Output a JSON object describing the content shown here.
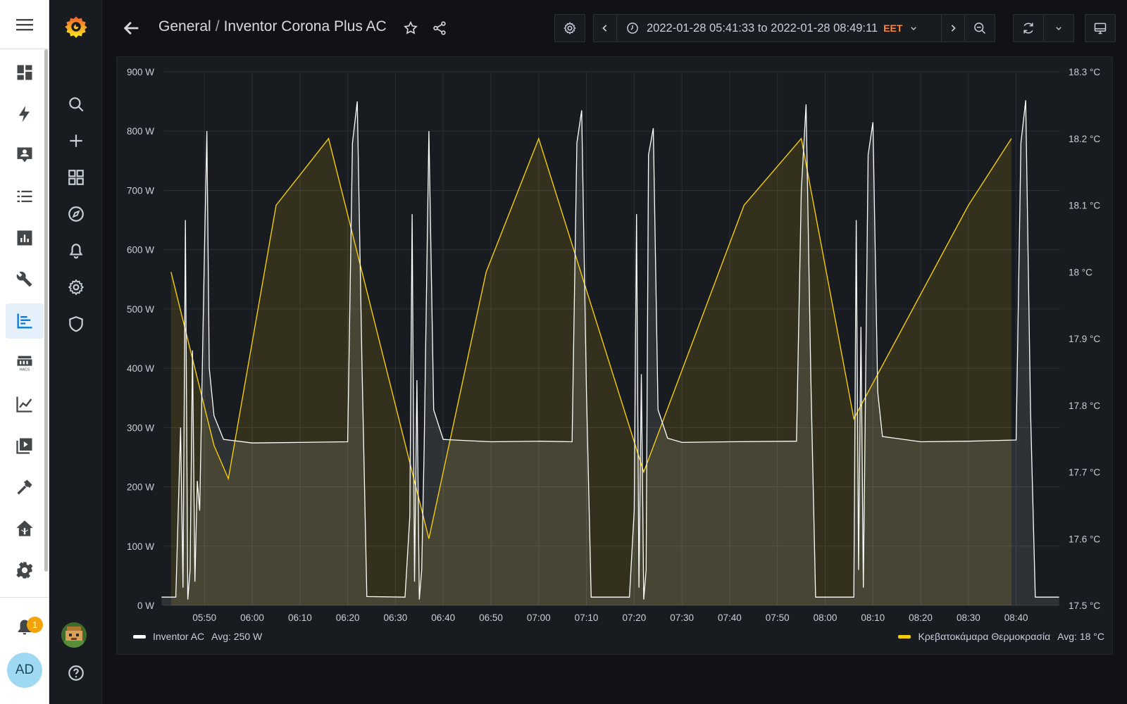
{
  "breadcrumb": {
    "folder": "General",
    "separator": "/",
    "dashboard": "Inventor Corona Plus AC"
  },
  "time_picker": {
    "range": "2022-01-28 05:41:33 to 2022-01-28 08:49:11",
    "timezone": "EET"
  },
  "notifications": {
    "count": "1"
  },
  "user": {
    "initials": "AD"
  },
  "colors": {
    "power": "#ffffff",
    "temperature": "#f2cc0c",
    "accent": "#f5883a"
  },
  "chart_data": {
    "type": "line",
    "x_ticks": [
      "05:50",
      "06:00",
      "06:10",
      "06:20",
      "06:30",
      "06:40",
      "06:50",
      "07:00",
      "07:10",
      "07:20",
      "07:30",
      "07:40",
      "07:50",
      "08:00",
      "08:10",
      "08:20",
      "08:30",
      "08:40"
    ],
    "y_left_ticks": [
      "900 W",
      "800 W",
      "700 W",
      "600 W",
      "500 W",
      "400 W",
      "300 W",
      "200 W",
      "100 W",
      "0 W"
    ],
    "y_right_ticks": [
      "18.3 °C",
      "18.2 °C",
      "18.1 °C",
      "18 °C",
      "17.9 °C",
      "17.8 °C",
      "17.7 °C",
      "17.6 °C",
      "17.5 °C"
    ],
    "y_left_range": [
      0,
      900
    ],
    "y_right_range": [
      17.5,
      18.3
    ],
    "grid": true,
    "series": [
      {
        "name": "Inventor AC",
        "legend_stat": "Avg: 250 W",
        "axis": "left",
        "points": [
          [
            "05:41",
            14
          ],
          [
            "05:44",
            14
          ],
          [
            "05:45",
            300
          ],
          [
            "05:45.5",
            30
          ],
          [
            "05:46",
            650
          ],
          [
            "05:46.5",
            10
          ],
          [
            "05:47",
            60
          ],
          [
            "05:47.5",
            430
          ],
          [
            "05:48",
            40
          ],
          [
            "05:48.5",
            210
          ],
          [
            "05:49",
            160
          ],
          [
            "05:50",
            600
          ],
          [
            "05:50.5",
            800
          ],
          [
            "05:51",
            400
          ],
          [
            "05:52",
            320
          ],
          [
            "05:54",
            280
          ],
          [
            "06:00",
            274
          ],
          [
            "06:10",
            275
          ],
          [
            "06:20",
            276
          ],
          [
            "06:21",
            780
          ],
          [
            "06:22",
            850
          ],
          [
            "06:23",
            400
          ],
          [
            "06:24",
            15
          ],
          [
            "06:32",
            14
          ],
          [
            "06:33",
            150
          ],
          [
            "06:33.5",
            660
          ],
          [
            "06:34",
            40
          ],
          [
            "06:34.5",
            380
          ],
          [
            "06:35",
            10
          ],
          [
            "06:35.5",
            60
          ],
          [
            "06:36",
            260
          ],
          [
            "06:37",
            800
          ],
          [
            "06:38",
            330
          ],
          [
            "06:40",
            280
          ],
          [
            "06:50",
            276
          ],
          [
            "07:00",
            277
          ],
          [
            "07:07",
            276
          ],
          [
            "07:08",
            780
          ],
          [
            "07:09",
            835
          ],
          [
            "07:10",
            360
          ],
          [
            "07:11",
            14
          ],
          [
            "07:19",
            14
          ],
          [
            "07:20",
            160
          ],
          [
            "07:20.5",
            660
          ],
          [
            "07:21",
            30
          ],
          [
            "07:21.5",
            390
          ],
          [
            "07:22",
            10
          ],
          [
            "07:22.5",
            60
          ],
          [
            "07:23",
            760
          ],
          [
            "07:24",
            805
          ],
          [
            "07:25",
            330
          ],
          [
            "07:27",
            282
          ],
          [
            "07:30",
            275
          ],
          [
            "07:40",
            276
          ],
          [
            "07:54",
            277
          ],
          [
            "07:55",
            700
          ],
          [
            "07:56",
            845
          ],
          [
            "07:57",
            380
          ],
          [
            "07:58",
            14
          ],
          [
            "08:06",
            14
          ],
          [
            "08:06.5",
            650
          ],
          [
            "08:07",
            60
          ],
          [
            "08:07.5",
            470
          ],
          [
            "08:08",
            30
          ],
          [
            "08:09",
            760
          ],
          [
            "08:10",
            815
          ],
          [
            "08:11",
            360
          ],
          [
            "08:12",
            285
          ],
          [
            "08:20",
            276
          ],
          [
            "08:30",
            277
          ],
          [
            "08:40",
            279
          ],
          [
            "08:41",
            780
          ],
          [
            "08:42",
            852
          ],
          [
            "08:43",
            330
          ],
          [
            "08:44",
            14
          ],
          [
            "08:49",
            14
          ]
        ]
      },
      {
        "name": "Κρεβατοκάμαρα Θερμοκρασία",
        "legend_stat": "Avg: 18 °C",
        "axis": "right",
        "points": [
          [
            "05:43",
            18.0
          ],
          [
            "05:52",
            17.74
          ],
          [
            "05:55",
            17.69
          ],
          [
            "06:05",
            18.1
          ],
          [
            "06:16",
            18.2
          ],
          [
            "06:37",
            17.6
          ],
          [
            "06:49",
            18.0
          ],
          [
            "07:00",
            18.2
          ],
          [
            "07:22",
            17.7
          ],
          [
            "07:43",
            18.1
          ],
          [
            "07:55",
            18.2
          ],
          [
            "08:06",
            17.78
          ],
          [
            "08:30",
            18.1
          ],
          [
            "08:39",
            18.2
          ]
        ]
      }
    ]
  }
}
